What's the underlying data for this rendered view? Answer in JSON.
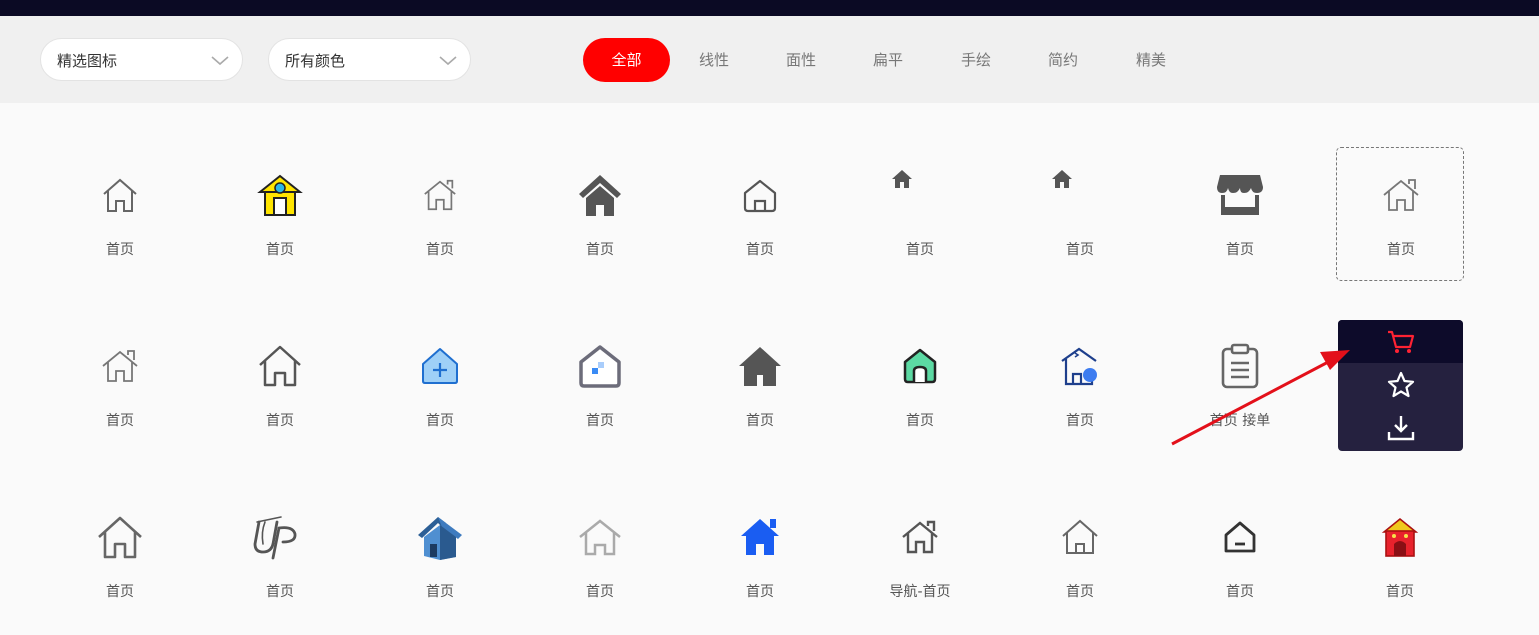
{
  "filters": {
    "select1": "精选图标",
    "select2": "所有颜色"
  },
  "tabs": [
    {
      "label": "全部",
      "active": true
    },
    {
      "label": "线性",
      "active": false
    },
    {
      "label": "面性",
      "active": false
    },
    {
      "label": "扁平",
      "active": false
    },
    {
      "label": "手绘",
      "active": false
    },
    {
      "label": "简约",
      "active": false
    },
    {
      "label": "精美",
      "active": false
    }
  ],
  "icons": [
    {
      "name": "首页",
      "icon": "house-line-icon"
    },
    {
      "name": "首页",
      "icon": "house-yellow-icon"
    },
    {
      "name": "首页",
      "icon": "house-chimney-line-icon"
    },
    {
      "name": "首页",
      "icon": "house-roof-solid-icon"
    },
    {
      "name": "首页",
      "icon": "house-rounded-line-icon"
    },
    {
      "name": "首页",
      "icon": "house-small-solid-icon"
    },
    {
      "name": "首页",
      "icon": "house-small-solid-icon"
    },
    {
      "name": "首页",
      "icon": "storefront-icon"
    },
    {
      "name": "首页",
      "icon": "house-chimney-line-icon"
    },
    {
      "name": "首页",
      "icon": "house-chimney-line-icon"
    },
    {
      "name": "首页",
      "icon": "house-line-icon"
    },
    {
      "name": "首页",
      "icon": "house-plus-blue-icon"
    },
    {
      "name": "首页",
      "icon": "house-pixel-icon"
    },
    {
      "name": "首页",
      "icon": "house-solid-icon"
    },
    {
      "name": "首页",
      "icon": "house-green-icon"
    },
    {
      "name": "首页",
      "icon": "house-blue-dot-icon"
    },
    {
      "name": "首页 接单",
      "icon": "clipboard-icon"
    },
    {
      "name": "首页",
      "icon": "house-line-icon"
    },
    {
      "name": "首页",
      "icon": "house-line-icon"
    },
    {
      "name": "首页",
      "icon": "up-handdrawn-icon"
    },
    {
      "name": "首页",
      "icon": "house-3d-blue-icon"
    },
    {
      "name": "首页",
      "icon": "house-light-line-icon"
    },
    {
      "name": "首页",
      "icon": "house-blue-solid-icon"
    },
    {
      "name": "导航-首页",
      "icon": "house-chimney-line-icon"
    },
    {
      "name": "首页",
      "icon": "house-line-icon"
    },
    {
      "name": "首页",
      "icon": "house-minimal-icon"
    },
    {
      "name": "首页",
      "icon": "house-red-icon"
    }
  ],
  "hover_menu": {
    "icons": [
      "cart-icon",
      "star-icon",
      "download-icon"
    ],
    "accent": "#ff2233"
  },
  "colors": {
    "topbar": "#0b0a24",
    "active_tab": "#ff0000",
    "menu": "#25213f"
  }
}
